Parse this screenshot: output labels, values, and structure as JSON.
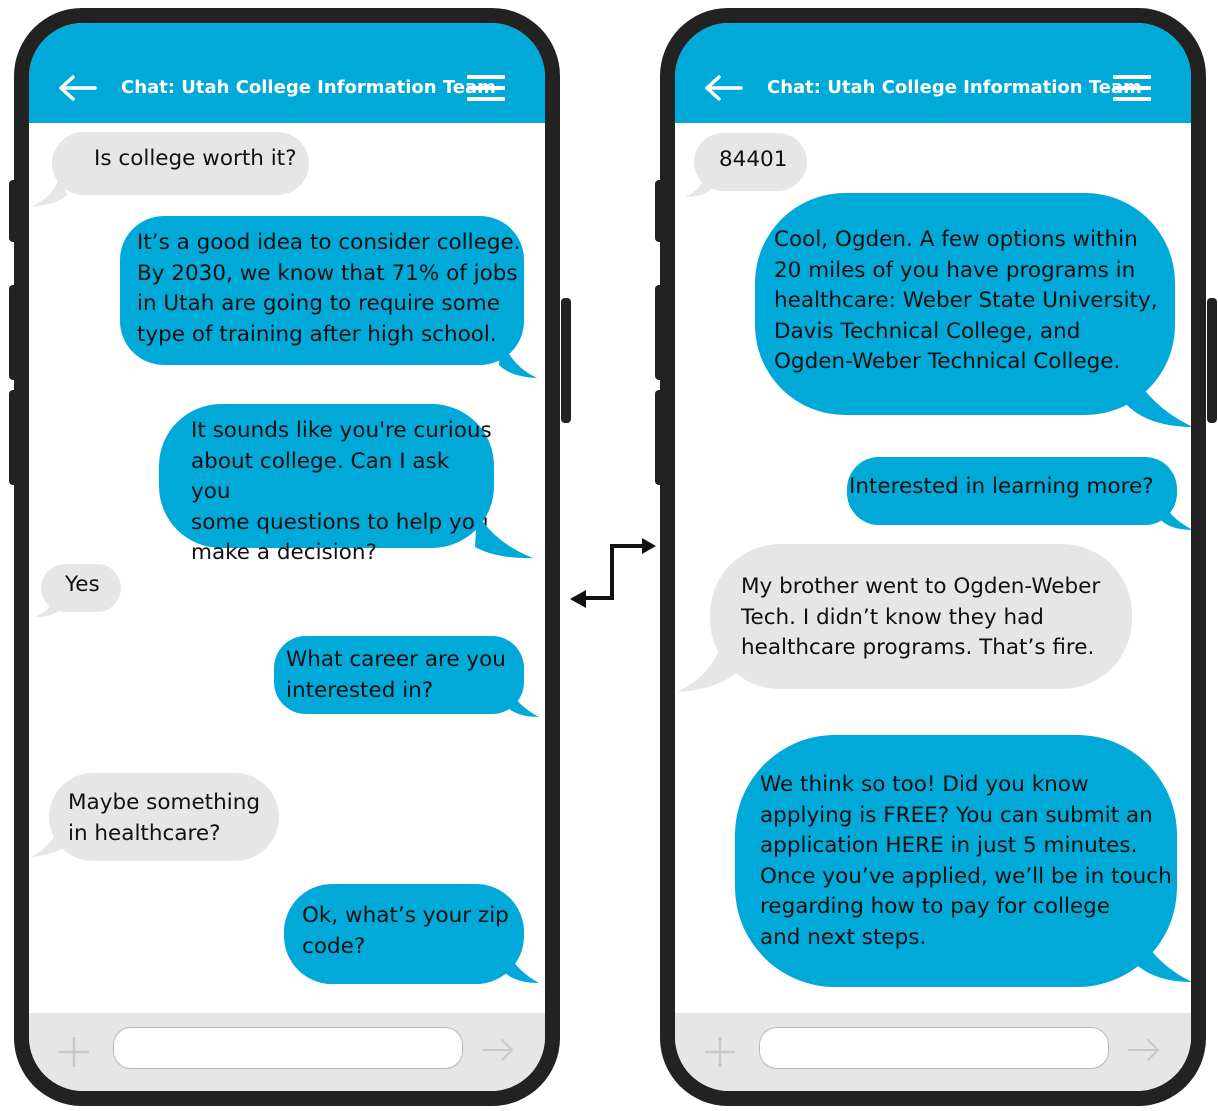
{
  "colors": {
    "accent": "#00a9d7",
    "incoming_bubble": "#e6e6e6",
    "phone_frame": "#222222"
  },
  "phones": [
    {
      "header": {
        "back_icon": "arrow-left-icon",
        "title": "Chat: Utah College Information Team",
        "menu_icon": "hamburger-menu-icon"
      },
      "messages": [
        {
          "side": "in",
          "text": "Is college worth it?"
        },
        {
          "side": "out",
          "text": "It’s a good idea to consider college.\nBy 2030, we know that 71% of jobs\nin Utah are going to require some\ntype of training after high school."
        },
        {
          "side": "out",
          "text": "It sounds like you're curious\nabout college. Can I ask you\nsome questions to help you\nmake a decision?"
        },
        {
          "side": "in",
          "text": "Yes"
        },
        {
          "side": "out",
          "text": "What career are you\ninterested in?"
        },
        {
          "side": "in",
          "text": "Maybe something\nin healthcare?"
        },
        {
          "side": "out",
          "text": "Ok, what’s your zip\ncode?"
        }
      ],
      "composer": {
        "add_icon": "plus-icon",
        "input_value": "",
        "send_icon": "arrow-right-icon"
      }
    },
    {
      "header": {
        "back_icon": "arrow-left-icon",
        "title": "Chat: Utah College Information Team",
        "menu_icon": "hamburger-menu-icon"
      },
      "messages": [
        {
          "side": "in",
          "text": "84401"
        },
        {
          "side": "out",
          "text": "Cool, Ogden. A few options within\n20 miles of you have programs in\nhealthcare: Weber State University,\nDavis Technical College, and\nOgden-Weber Technical College."
        },
        {
          "side": "out",
          "text": "Interested in learning more?"
        },
        {
          "side": "in",
          "text": "My brother went to Ogden-Weber\nTech. I didn’t know they had\nhealthcare programs. That’s fire."
        },
        {
          "side": "out",
          "text": "We think so too! Did you know\napplying is FREE? You can submit an\napplication HERE in just 5 minutes.\nOnce you’ve applied, we’ll be in touch\nregarding how to pay for college\nand next steps."
        }
      ],
      "composer": {
        "add_icon": "plus-icon",
        "input_value": "",
        "send_icon": "arrow-right-icon"
      }
    }
  ],
  "connector_icon": "swap-arrows-icon"
}
